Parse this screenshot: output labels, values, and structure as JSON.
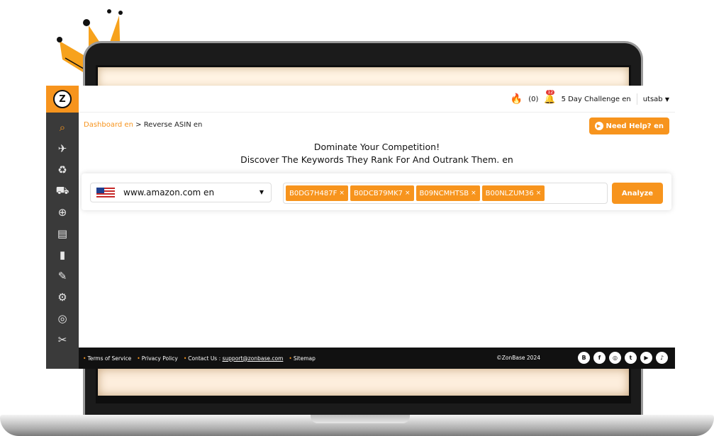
{
  "colors": {
    "accent": "#f7941d",
    "sidebar": "#3a3a3a",
    "footer": "#111111"
  },
  "logo": {
    "letter": "Z"
  },
  "sidebar": {
    "items": [
      {
        "icon": "search-tag-icon",
        "glyph": "⌕",
        "active": true
      },
      {
        "icon": "telescope-icon",
        "glyph": "✈"
      },
      {
        "icon": "recycle-icon",
        "glyph": "♻"
      },
      {
        "icon": "cart-icon",
        "glyph": "⛟"
      },
      {
        "icon": "zoom-icon",
        "glyph": "⊕"
      },
      {
        "icon": "clipboard-icon",
        "glyph": "▤"
      },
      {
        "icon": "chart-icon",
        "glyph": "▮"
      },
      {
        "icon": "edit-icon",
        "glyph": "✎"
      },
      {
        "icon": "magnify-settings-icon",
        "glyph": "⚙"
      },
      {
        "icon": "target-icon",
        "glyph": "◎"
      },
      {
        "icon": "tools-icon",
        "glyph": "✂"
      }
    ]
  },
  "topbar": {
    "fire_count": "(0)",
    "notification_count": "12",
    "challenge": "5 Day Challenge en",
    "user": "utsab"
  },
  "breadcrumb": {
    "link": "Dashboard en",
    "separator": ">",
    "current": "Reverse ASIN en"
  },
  "help_button": "Need Help? en",
  "headline": {
    "line1": "Dominate Your Competition!",
    "line2": "Discover The Keywords They Rank For And Outrank Them. en"
  },
  "search": {
    "marketplace": "www.amazon.com en",
    "asins": [
      "B0DG7H487F",
      "B0DCB79MK7",
      "B09NCMHTSB",
      "B00NLZUM36"
    ],
    "chip_remove": "×",
    "analyze_label": "Analyze"
  },
  "footer": {
    "terms": "Terms of Service",
    "privacy": "Privacy Policy",
    "contact_label": "Contact Us :",
    "contact_email": "support@zonbase.com",
    "sitemap": "Sitemap",
    "copyright": "©ZonBase 2024",
    "socials": [
      {
        "icon": "blogger-icon",
        "glyph": "B"
      },
      {
        "icon": "facebook-icon",
        "glyph": "f"
      },
      {
        "icon": "instagram-icon",
        "glyph": "◎"
      },
      {
        "icon": "twitter-icon",
        "glyph": "t"
      },
      {
        "icon": "youtube-icon",
        "glyph": "▶"
      },
      {
        "icon": "tiktok-icon",
        "glyph": "♪"
      }
    ]
  }
}
